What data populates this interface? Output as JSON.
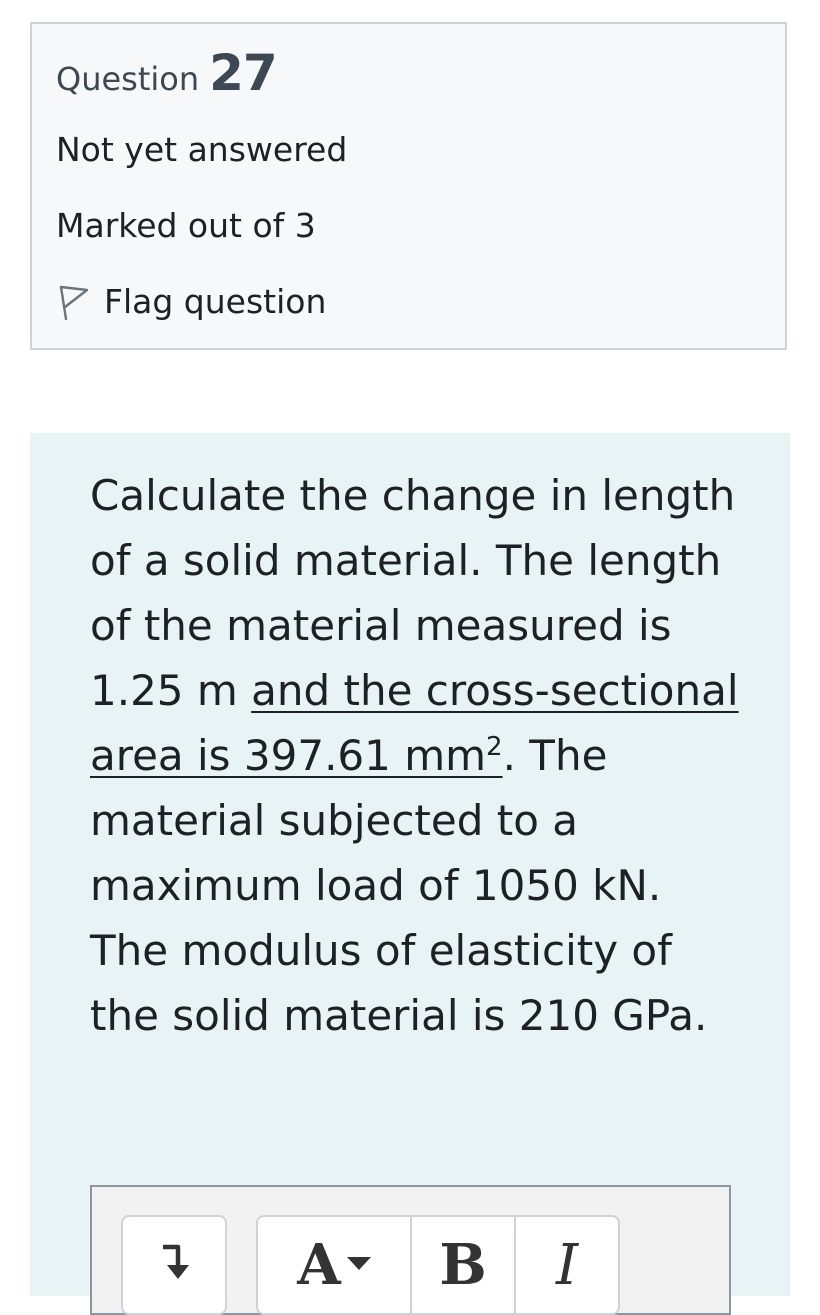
{
  "question": {
    "label": "Question",
    "number": "27",
    "state": "Not yet answered",
    "grade": "Marked out of 3",
    "flag_label": "Flag question"
  },
  "qtext": {
    "part1": "Calculate the change in length of a solid material. The length of the material measured is 1.25 m ",
    "underlined": "and the cross-sectional area is 397.61 mm",
    "superscript": "2",
    "part2": ". The material subjected to a maximum load of 1050 kN. The modulus of elasticity of the solid material is 210 GPa."
  },
  "editor": {
    "toolbar": {
      "font_button": "A",
      "bold_button": "B",
      "italic_button": "I"
    }
  },
  "icons": {
    "flag": "flag-outline-icon",
    "collapse": "arrow-down-to-line-icon",
    "dropdown": "caret-down-icon"
  },
  "colors": {
    "info_background": "#f7f8f9",
    "content_background": "#e7f3f5",
    "heading_text": "#3d4852",
    "body_text": "#1d2125"
  }
}
